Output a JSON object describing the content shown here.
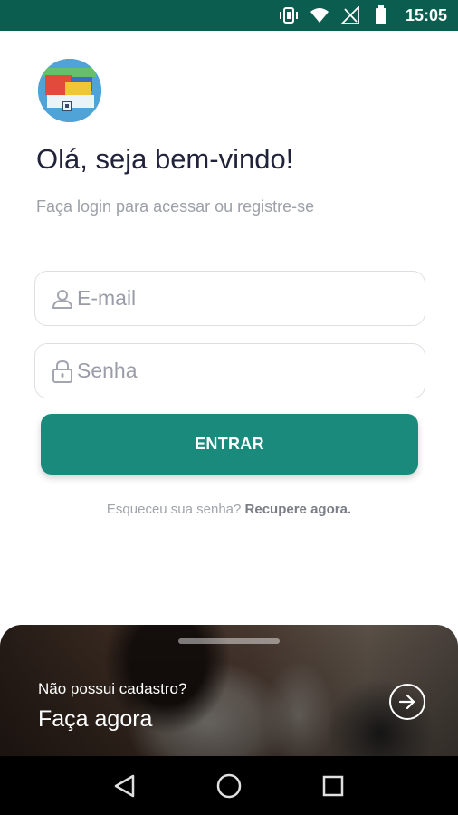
{
  "status_bar": {
    "time": "15:05",
    "background": "#0b5e4f",
    "icons": [
      "vibrate-icon",
      "wifi-icon",
      "no-signal-icon",
      "battery-icon"
    ]
  },
  "logo": {
    "name": "app-logo"
  },
  "welcome": {
    "title": "Olá, seja bem-vindo!",
    "subtitle": "Faça login para acessar ou registre-se"
  },
  "form": {
    "email_placeholder": "E-mail",
    "email_value": "",
    "password_placeholder": "Senha",
    "password_value": "",
    "email_icon": "user-icon",
    "password_icon": "lock-icon"
  },
  "login_button": {
    "label": "ENTRAR",
    "color": "#1a8a7d"
  },
  "forgot": {
    "prefix": "Esqueceu sua senha?",
    "link": "Recupere agora."
  },
  "signup": {
    "question": "Não possui cadastro?",
    "action": "Faça agora",
    "arrow_icon": "arrow-right-circle-icon"
  },
  "nav_bar": {
    "buttons": [
      "back-icon",
      "home-icon",
      "recents-icon"
    ]
  }
}
